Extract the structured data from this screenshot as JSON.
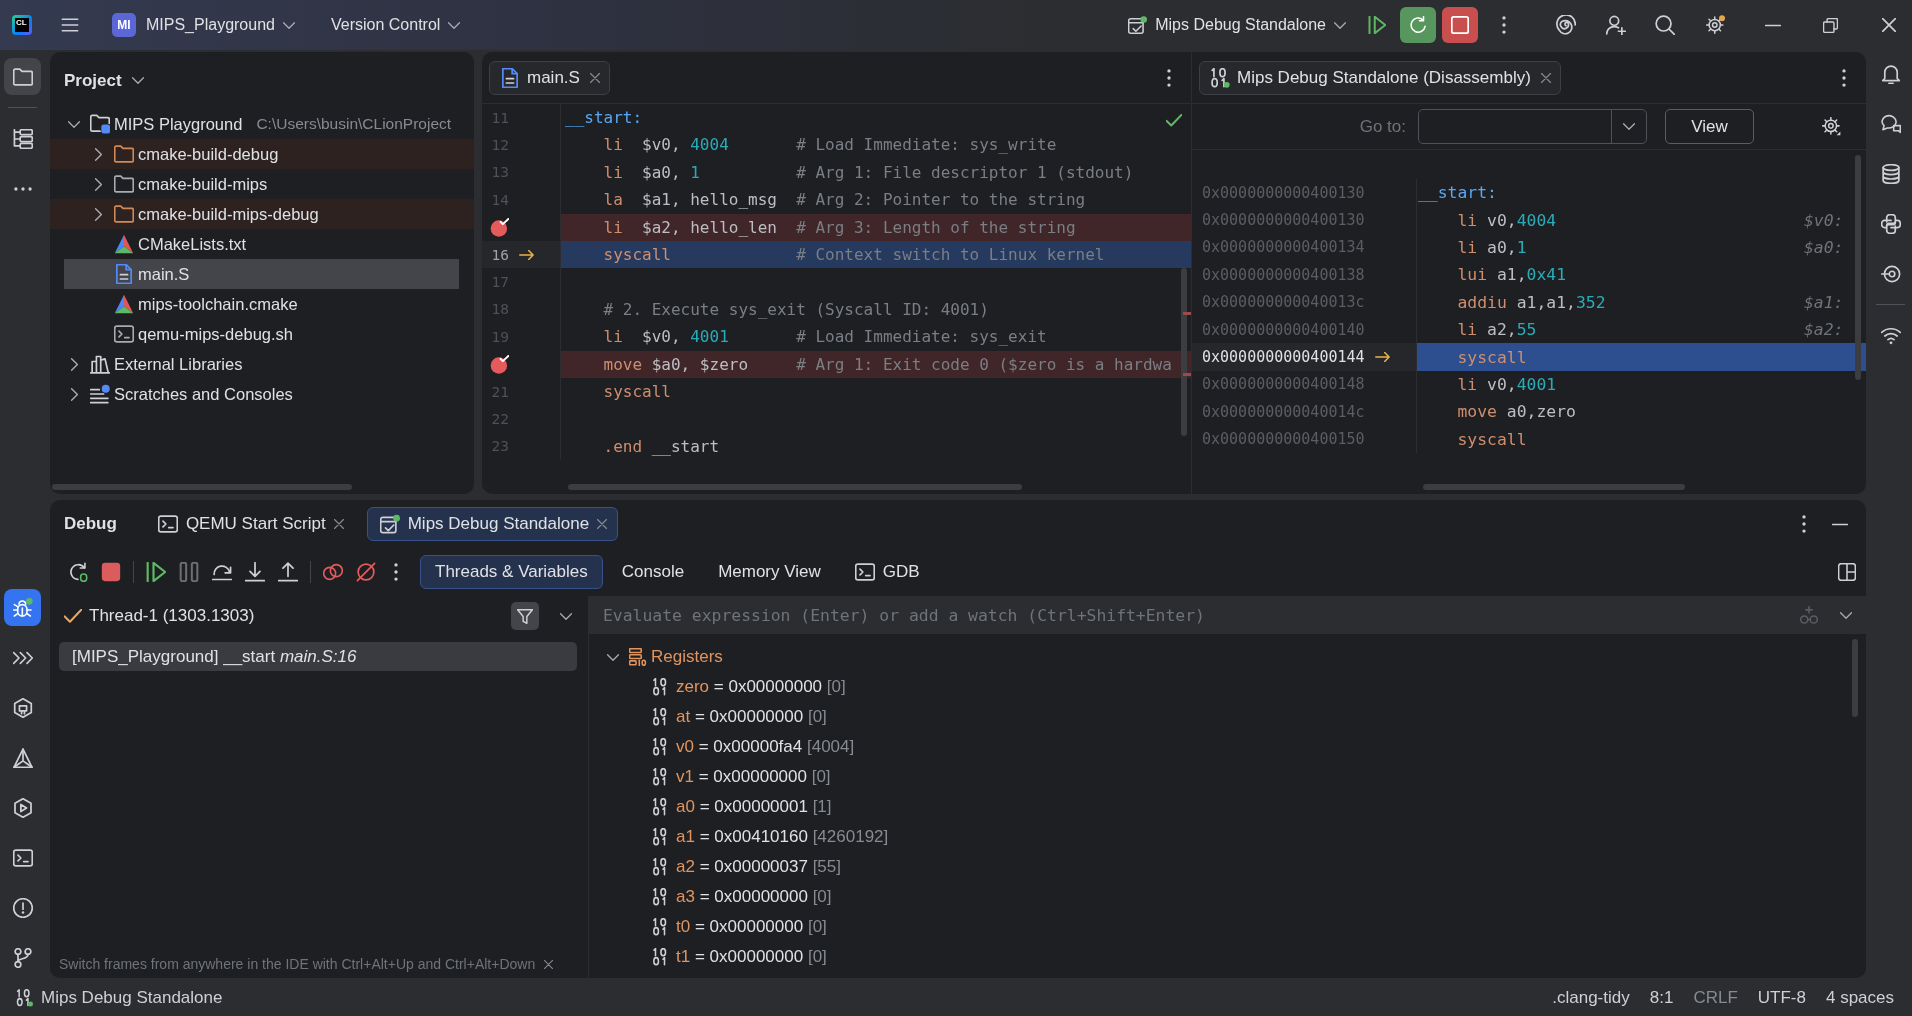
{
  "title_bar": {
    "logo": "CL",
    "project_badge": "MI",
    "project": "MIPS_Playground",
    "vcs": "Version Control",
    "run_config": "Mips Debug Standalone"
  },
  "left_stripe": {
    "top": [
      [
        {
          "kind": "project",
          "selected": true
        }
      ],
      [
        {
          "kind": "structure",
          "selected": false
        },
        {
          "kind": "more",
          "selected": false
        }
      ]
    ],
    "bottom": [
      {
        "kind": "debug",
        "selected": true
      },
      {
        "kind": "run_tools",
        "selected": false
      },
      {
        "kind": "services",
        "selected": false
      },
      {
        "kind": "cmake",
        "selected": false
      },
      {
        "kind": "run",
        "selected": false
      },
      {
        "kind": "terminal",
        "selected": false
      },
      {
        "kind": "problems",
        "selected": false
      },
      {
        "kind": "git",
        "selected": false
      }
    ]
  },
  "right_stripe": [
    [
      {
        "kind": "notifications",
        "selected": false
      },
      {
        "kind": "ai_chat",
        "selected": false
      },
      {
        "kind": "database",
        "selected": false
      },
      {
        "kind": "python",
        "selected": false
      },
      {
        "kind": "target",
        "selected": false
      }
    ],
    [
      {
        "kind": "wifi",
        "selected": false
      }
    ]
  ],
  "project_panel": {
    "title": "Project",
    "tree": [
      {
        "label": "MIPS Playground",
        "path": "C:\\Users\\busin\\CLionProject",
        "kind": "project",
        "expanded": true,
        "selected": false,
        "children": [
          {
            "label": "cmake-build-debug",
            "kind": "excluded_folder",
            "expanded": false,
            "selected": false
          },
          {
            "label": "cmake-build-mips",
            "kind": "folder",
            "expanded": false,
            "selected": false
          },
          {
            "label": "cmake-build-mips-debug",
            "kind": "excluded_folder",
            "expanded": false,
            "selected": false
          },
          {
            "label": "CMakeLists.txt",
            "kind": "cmake",
            "selected": false
          },
          {
            "label": "main.S",
            "kind": "asm",
            "selected": true
          },
          {
            "label": "mips-toolchain.cmake",
            "kind": "cmake",
            "selected": false
          },
          {
            "label": "qemu-mips-debug.sh",
            "kind": "shell",
            "selected": false
          }
        ]
      },
      {
        "label": "External Libraries",
        "kind": "libraries",
        "expanded": false,
        "selected": false
      },
      {
        "label": "Scratches and Consoles",
        "kind": "scratches",
        "expanded": false,
        "selected": false
      }
    ]
  },
  "editor": {
    "tabs": [
      {
        "label": "main.S",
        "kind": "asm",
        "selected": true
      }
    ],
    "lines": [
      {
        "number": "11",
        "kind": "label",
        "breakpoint": false,
        "current": false,
        "code": [
          {
            "kind": "label",
            "text": "__start:"
          }
        ]
      },
      {
        "number": "12",
        "kind": "code",
        "breakpoint": false,
        "current": false,
        "code": [
          {
            "kind": "keyword",
            "text": "li"
          },
          {
            "kind": "plain",
            "text": "  $v0, "
          },
          {
            "kind": "number",
            "text": "4004"
          }
        ],
        "comment": "# Load Immediate: sys_write"
      },
      {
        "number": "13",
        "kind": "code",
        "breakpoint": false,
        "current": false,
        "code": [
          {
            "kind": "keyword",
            "text": "li"
          },
          {
            "kind": "plain",
            "text": "  $a0, "
          },
          {
            "kind": "number",
            "text": "1"
          }
        ],
        "comment": "# Arg 1: File descriptor 1 (stdout)"
      },
      {
        "number": "14",
        "kind": "code",
        "breakpoint": false,
        "current": false,
        "code": [
          {
            "kind": "keyword",
            "text": "la"
          },
          {
            "kind": "plain",
            "text": "  $a1, hello_msg"
          }
        ],
        "comment": "# Arg 2: Pointer to the string"
      },
      {
        "kind": "code",
        "breakpoint": true,
        "current": false,
        "code": [
          {
            "kind": "keyword",
            "text": "li"
          },
          {
            "kind": "plain",
            "text": "  $a2, hello_len"
          }
        ],
        "comment": "# Arg 3: Length of the string"
      },
      {
        "number": "16",
        "kind": "code",
        "breakpoint": false,
        "current": true,
        "code": [
          {
            "kind": "keyword",
            "text": "syscall"
          }
        ],
        "comment": "# Context switch to Linux kernel"
      },
      {
        "number": "17",
        "kind": "blank",
        "breakpoint": false,
        "current": false
      },
      {
        "number": "18",
        "kind": "comment",
        "breakpoint": false,
        "current": false,
        "comment": "# 2. Execute sys_exit (Syscall ID: 4001)"
      },
      {
        "number": "19",
        "kind": "code",
        "breakpoint": false,
        "current": false,
        "code": [
          {
            "kind": "keyword",
            "text": "li"
          },
          {
            "kind": "plain",
            "text": "  $v0, "
          },
          {
            "kind": "number",
            "text": "4001"
          }
        ],
        "comment": "# Load Immediate: sys_exit"
      },
      {
        "kind": "code",
        "breakpoint": true,
        "current": false,
        "code": [
          {
            "kind": "keyword",
            "text": "move"
          },
          {
            "kind": "plain",
            "text": " $a0, $zero"
          }
        ],
        "comment": "# Arg 1: Exit code 0 ($zero is a hardwa"
      },
      {
        "number": "21",
        "kind": "code",
        "breakpoint": false,
        "current": false,
        "code": [
          {
            "kind": "keyword",
            "text": "syscall"
          }
        ]
      },
      {
        "number": "22",
        "kind": "blank",
        "breakpoint": false,
        "current": false
      },
      {
        "number": "23",
        "kind": "code",
        "breakpoint": false,
        "current": false,
        "code": [
          {
            "kind": "keyword",
            "text": ".end"
          },
          {
            "kind": "plain",
            "text": " __start"
          }
        ]
      }
    ]
  },
  "disassembly": {
    "tabs": [
      {
        "label": "Mips Debug Standalone (Disassembly)",
        "kind": "binary",
        "selected": true
      }
    ],
    "goto": {
      "label": "Go to:"
    },
    "view_button": "View",
    "rows": [
      {
        "address": "0x0000000000400130",
        "kind": "label",
        "current": false,
        "code": [
          {
            "kind": "label",
            "text": "__start:"
          }
        ]
      },
      {
        "address": "0x0000000000400130",
        "kind": "code",
        "current": false,
        "code": [
          {
            "kind": "keyword",
            "text": "li"
          },
          {
            "kind": "plain",
            "text": " v0,"
          },
          {
            "kind": "number",
            "text": "4004"
          }
        ],
        "hint": "$v0:"
      },
      {
        "address": "0x0000000000400134",
        "kind": "code",
        "current": false,
        "code": [
          {
            "kind": "keyword",
            "text": "li"
          },
          {
            "kind": "plain",
            "text": " a0,"
          },
          {
            "kind": "number",
            "text": "1"
          }
        ],
        "hint": "$a0:"
      },
      {
        "address": "0x0000000000400138",
        "kind": "code",
        "current": false,
        "code": [
          {
            "kind": "keyword",
            "text": "lui"
          },
          {
            "kind": "plain",
            "text": " a1,"
          },
          {
            "kind": "number",
            "text": "0x41"
          }
        ]
      },
      {
        "address": "0x000000000040013c",
        "kind": "code",
        "current": false,
        "code": [
          {
            "kind": "keyword",
            "text": "addiu"
          },
          {
            "kind": "plain",
            "text": " a1,a1,"
          },
          {
            "kind": "number",
            "text": "352"
          }
        ],
        "hint": "$a1:"
      },
      {
        "address": "0x0000000000400140",
        "kind": "code",
        "current": false,
        "code": [
          {
            "kind": "keyword",
            "text": "li"
          },
          {
            "kind": "plain",
            "text": " a2,"
          },
          {
            "kind": "number",
            "text": "55"
          }
        ],
        "hint": "$a2:"
      },
      {
        "address": "0x0000000000400144",
        "kind": "code",
        "current": true,
        "code": [
          {
            "kind": "keyword",
            "text": "syscall"
          }
        ]
      },
      {
        "address": "0x0000000000400148",
        "kind": "code",
        "current": false,
        "code": [
          {
            "kind": "keyword",
            "text": "li"
          },
          {
            "kind": "plain",
            "text": " v0,"
          },
          {
            "kind": "number",
            "text": "4001"
          }
        ]
      },
      {
        "address": "0x000000000040014c",
        "kind": "code",
        "current": false,
        "code": [
          {
            "kind": "keyword",
            "text": "move"
          },
          {
            "kind": "plain",
            "text": " a0,zero"
          }
        ]
      },
      {
        "address": "0x0000000000400150",
        "kind": "code",
        "current": false,
        "code": [
          {
            "kind": "keyword",
            "text": "syscall"
          }
        ]
      }
    ]
  },
  "debug": {
    "title": "Debug",
    "tabs": [
      {
        "label": "QEMU Start Script",
        "kind": "terminal",
        "selected": false
      },
      {
        "label": "Mips Debug Standalone",
        "kind": "debug",
        "selected": true
      }
    ],
    "toolbar": [
      [
        {
          "kind": "rerun",
          "disabled": false
        },
        {
          "kind": "stop",
          "disabled": false
        }
      ],
      [
        {
          "kind": "resume",
          "disabled": false
        },
        {
          "kind": "pause",
          "disabled": true
        },
        {
          "kind": "step_over",
          "disabled": false
        },
        {
          "kind": "step_into",
          "disabled": false
        },
        {
          "kind": "step_out",
          "disabled": false
        }
      ],
      [
        {
          "kind": "breakpoints",
          "disabled": false
        },
        {
          "kind": "mute_breakpoints",
          "disabled": false
        },
        {
          "kind": "more",
          "disabled": false
        }
      ]
    ],
    "view_tabs": [
      {
        "label": "Threads & Variables",
        "kind": "text",
        "selected": true
      },
      {
        "label": "Console",
        "kind": "text",
        "selected": false
      },
      {
        "label": "Memory View",
        "kind": "text",
        "selected": false
      },
      {
        "label": "GDB",
        "kind": "terminal",
        "selected": false
      }
    ],
    "thread": {
      "label": "Thread-1 (1303.1303)"
    },
    "frames": [
      {
        "text": "[MIPS_Playground] __start *main.S:16*",
        "selected": true
      }
    ],
    "frames_hint": "Switch frames from anywhere in the IDE with Ctrl+Alt+Up and Ctrl+Alt+Down",
    "evaluate": {
      "placeholder": "Evaluate expression (Enter) or add a watch (Ctrl+Shift+Enter)"
    },
    "variables": [
      {
        "label": "Registers",
        "expanded": true,
        "children": [
          {
            "name": "zero",
            "value": "= 0x00000000",
            "decimal": "[0]"
          },
          {
            "name": "at",
            "value": "= 0x00000000",
            "decimal": "[0]"
          },
          {
            "name": "v0",
            "value": "= 0x00000fa4",
            "decimal": "[4004]"
          },
          {
            "name": "v1",
            "value": "= 0x00000000",
            "decimal": "[0]"
          },
          {
            "name": "a0",
            "value": "= 0x00000001",
            "decimal": "[1]"
          },
          {
            "name": "a1",
            "value": "= 0x00410160",
            "decimal": "[4260192]"
          },
          {
            "name": "a2",
            "value": "= 0x00000037",
            "decimal": "[55]"
          },
          {
            "name": "a3",
            "value": "= 0x00000000",
            "decimal": "[0]"
          },
          {
            "name": "t0",
            "value": "= 0x00000000",
            "decimal": "[0]"
          },
          {
            "name": "t1",
            "value": "= 0x00000000",
            "decimal": "[0]"
          }
        ]
      }
    ]
  },
  "status_bar": {
    "run_config": "Mips Debug Standalone",
    "items": [
      {
        "text": ".clang-tidy",
        "disabled": false
      },
      {
        "text": "8:1",
        "disabled": false
      },
      {
        "text": "CRLF",
        "disabled": true
      },
      {
        "text": "UTF-8",
        "disabled": false
      },
      {
        "text": "4 spaces",
        "disabled": false
      }
    ]
  }
}
